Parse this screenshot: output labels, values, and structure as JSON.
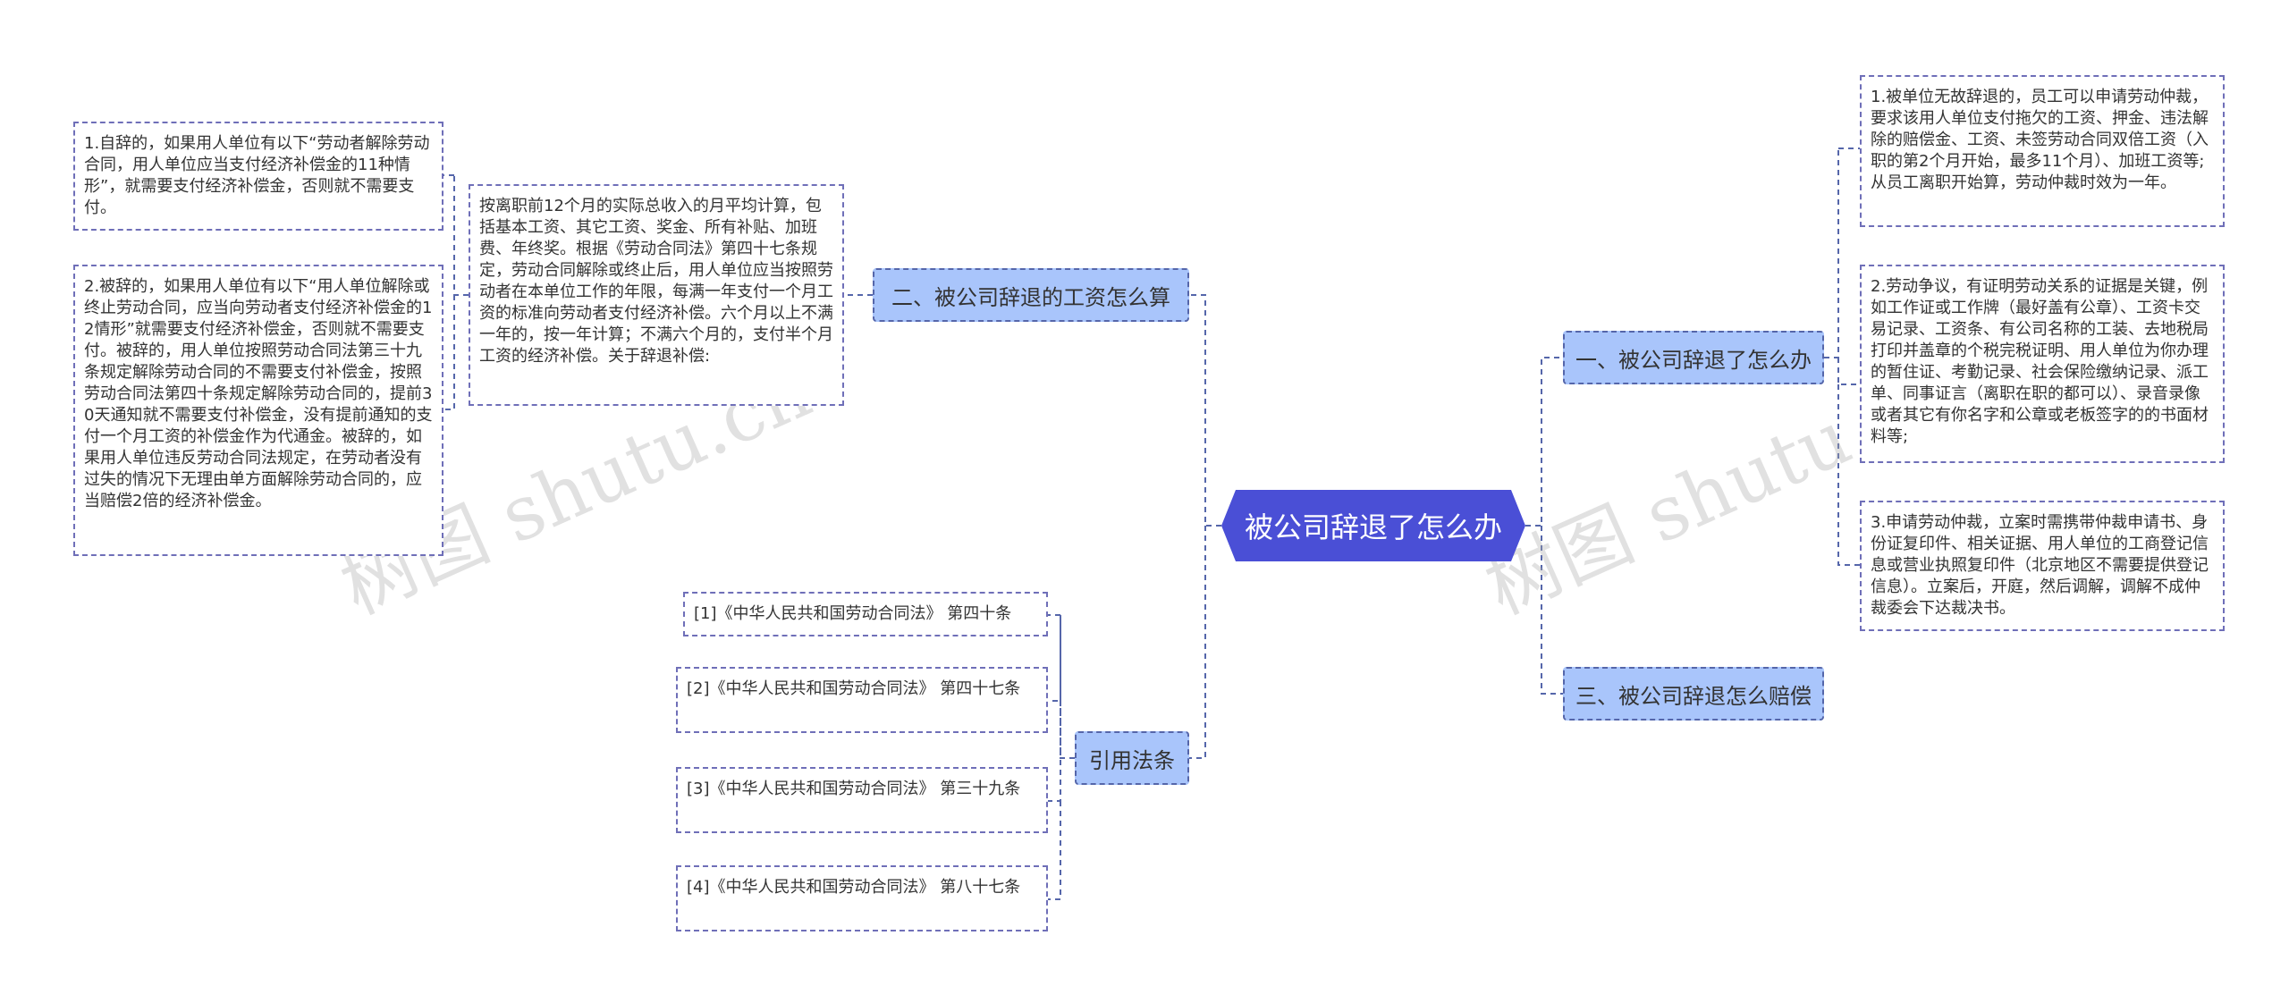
{
  "root": {
    "label": "被公司辞退了怎么办"
  },
  "branches": {
    "b1": {
      "label": "一、被公司辞退了怎么办"
    },
    "b2": {
      "label": "二、被公司辞退的工资怎么算"
    },
    "b3": {
      "label": "三、被公司辞退怎么赔偿"
    },
    "b4": {
      "label": "引用法条"
    }
  },
  "leaves": {
    "r1": "1.被单位无故辞退的，员工可以申请劳动仲裁，要求该用人单位支付拖欠的工资、押金、违法解除的赔偿金、工资、未签劳动合同双倍工资（入职的第2个月开始，最多11个月）、加班工资等;从员工离职开始算，劳动仲裁时效为一年。",
    "r2": "2.劳动争议，有证明劳动关系的证据是关键，例如工作证或工作牌（最好盖有公章）、工资卡交易记录、工资条、有公司名称的工装、去地税局打印并盖章的个税完税证明、用人单位为你办理的暂住证、考勤记录、社会保险缴纳记录、派工单、同事证言（离职在职的都可以）、录音录像或者其它有你名字和公章或老板签字的的书面材料等;",
    "r3": "3.申请劳动仲裁，立案时需携带仲裁申请书、身份证复印件、相关证据、用人单位的工商登记信息或营业执照复印件（北京地区不需要提供登记信息）。立案后，开庭，然后调解，调解不成仲裁委会下达裁决书。",
    "m1": "按离职前12个月的实际总收入的月平均计算，包括基本工资、其它工资、奖金、所有补贴、加班费、年终奖。根据《劳动合同法》第四十七条规定，劳动合同解除或终止后，用人单位应当按照劳动者在本单位工作的年限，每满一年支付一个月工资的标准向劳动者支付经济补偿。六个月以上不满一年的，按一年计算；不满六个月的，支付半个月工资的经济补偿。关于辞退补偿:",
    "l1": "1.自辞的，如果用人单位有以下“劳动者解除劳动合同，用人单位应当支付经济补偿金的11种情形”，就需要支付经济补偿金，否则就不需要支付。",
    "l2": "2.被辞的，如果用人单位有以下“用人单位解除或终止劳动合同，应当向劳动者支付经济补偿金的12情形”就需要支付经济补偿金，否则就不需要支付。被辞的，用人单位按照劳动合同法第三十九条规定解除劳动合同的不需要支付补偿金，按照劳动合同法第四十条规定解除劳动合同的，提前30天通知就不需要支付补偿金，没有提前通知的支付一个月工资的补偿金作为代通金。被辞的，如果用人单位违反劳动合同法规定，在劳动者没有过失的情况下无理由单方面解除劳动合同的，应当赔偿2倍的经济补偿金。",
    "c1": "[1]《中华人民共和国劳动合同法》 第四十条",
    "c2": "[2]《中华人民共和国劳动合同法》 第四十七条",
    "c3": "[3]《中华人民共和国劳动合同法》 第三十九条",
    "c4": "[4]《中华人民共和国劳动合同法》 第八十七条"
  },
  "watermark": "树图 shutu.cn",
  "colors": {
    "root": "#4a4fd6",
    "branch": "#a9c5fb",
    "line": "#5566aa",
    "leaf_border": "#6f6fb8"
  }
}
